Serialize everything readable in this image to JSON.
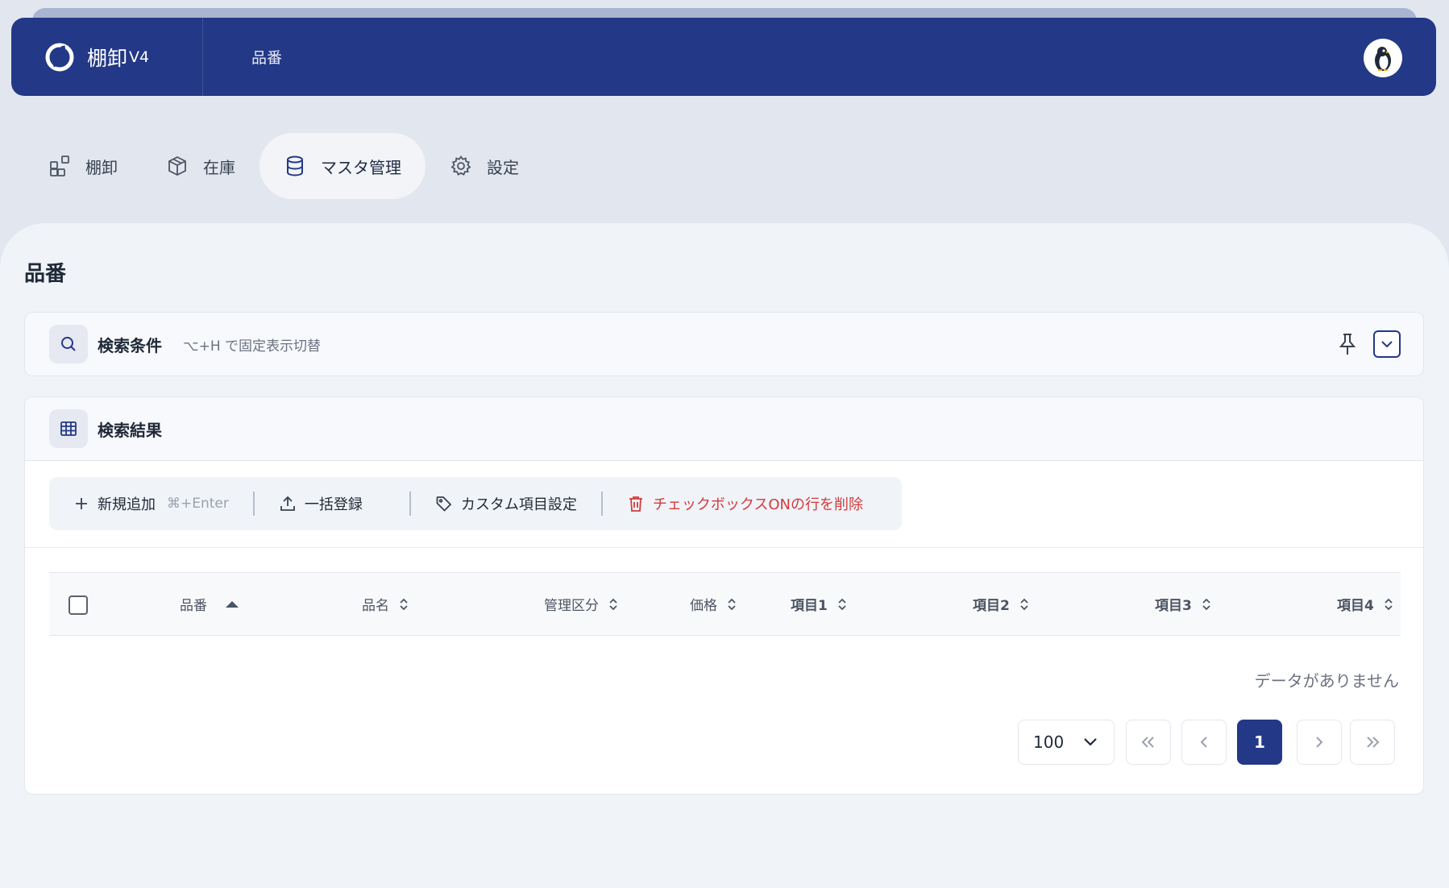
{
  "header": {
    "app_name": "棚卸",
    "app_version": "V4",
    "breadcrumb": "品番",
    "avatar_icon": "penguin-avatar"
  },
  "nav": {
    "items": [
      {
        "label": "棚卸",
        "icon": "blocks-icon",
        "active": false
      },
      {
        "label": "在庫",
        "icon": "box-icon",
        "active": false
      },
      {
        "label": "マスタ管理",
        "icon": "database-icon",
        "active": true
      },
      {
        "label": "設定",
        "icon": "gear-icon",
        "active": false
      }
    ]
  },
  "page": {
    "title": "品番"
  },
  "search": {
    "title": "検索条件",
    "hint": "⌥+H で固定表示切替"
  },
  "results": {
    "title": "検索結果",
    "toolbar": {
      "add_label": "新規追加",
      "add_shortcut": "⌘+Enter",
      "bulk_label": "一括登録",
      "custom_label": "カスタム項目設定",
      "delete_label": "チェックボックスONの行を削除"
    },
    "columns": [
      "品番",
      "品名",
      "管理区分",
      "価格",
      "項目1",
      "項目2",
      "項目3",
      "項目4"
    ],
    "sort": {
      "column": "品番",
      "direction": "asc"
    },
    "empty_message": "データがありません"
  },
  "pagination": {
    "page_size": "100",
    "current_page": "1"
  },
  "colors": {
    "primary": "#233886",
    "danger": "#d23b3b",
    "background": "#e2e7ef"
  }
}
